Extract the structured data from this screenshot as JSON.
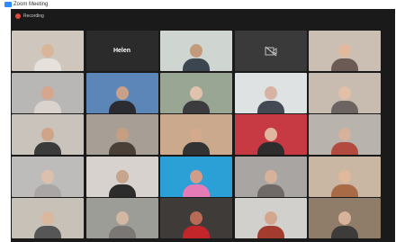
{
  "window": {
    "title": "Zoom Meeting"
  },
  "status": {
    "label": "Recording"
  },
  "tiles": [
    {
      "name": "",
      "kind": "person",
      "bg": "#cfc6be",
      "skin": "#d9b59a",
      "shirt": "#e6e1dc",
      "big_name": ""
    },
    {
      "name": "",
      "kind": "text",
      "bg": "#2b2b2b",
      "skin": "",
      "shirt": "",
      "big_name": "Helen"
    },
    {
      "name": "",
      "kind": "person",
      "bg": "#cfd6d2",
      "skin": "#c49a7d",
      "shirt": "#3b4650",
      "big_name": ""
    },
    {
      "name": "",
      "kind": "camoff",
      "bg": "#3a3a3a",
      "skin": "",
      "shirt": "",
      "big_name": ""
    },
    {
      "name": "",
      "kind": "person",
      "bg": "#cbbfb3",
      "skin": "#e0b99f",
      "shirt": "#6b5b54",
      "big_name": ""
    },
    {
      "name": "",
      "kind": "person",
      "bg": "#b9b7b6",
      "skin": "#d6a68d",
      "shirt": "#d9d2cd",
      "big_name": ""
    },
    {
      "name": "",
      "kind": "person",
      "bg": "#5c86b7",
      "skin": "#c9a08a",
      "shirt": "#2b2c32",
      "big_name": ""
    },
    {
      "name": "",
      "kind": "person",
      "bg": "#9aa694",
      "skin": "#e0c2ad",
      "shirt": "#3c3b3e",
      "big_name": ""
    },
    {
      "name": "",
      "kind": "person",
      "bg": "#dfe2e2",
      "skin": "#d6b3a2",
      "shirt": "#444a54",
      "big_name": ""
    },
    {
      "name": "",
      "kind": "person",
      "bg": "#c8bbaf",
      "skin": "#e2c0a8",
      "shirt": "#6b6460",
      "big_name": ""
    },
    {
      "name": "",
      "kind": "person",
      "bg": "#c9c3bc",
      "skin": "#cfa488",
      "shirt": "#3b3b3b",
      "big_name": ""
    },
    {
      "name": "",
      "kind": "person",
      "bg": "#a79f95",
      "skin": "#c69f83",
      "shirt": "#4b4038",
      "big_name": ""
    },
    {
      "name": "",
      "kind": "person",
      "bg": "#caa98c",
      "skin": "#d3aa8c",
      "shirt": "#333333",
      "big_name": ""
    },
    {
      "name": "",
      "kind": "person",
      "bg": "#c73a44",
      "skin": "#e0b6a0",
      "shirt": "#2d2d2d",
      "big_name": ""
    },
    {
      "name": "",
      "kind": "person",
      "bg": "#b8b3ad",
      "skin": "#d6b19b",
      "shirt": "#b24a3f",
      "big_name": ""
    },
    {
      "name": "",
      "kind": "person",
      "bg": "#bebcbb",
      "skin": "#dcc0ae",
      "shirt": "#aaa6a6",
      "big_name": ""
    },
    {
      "name": "",
      "kind": "person",
      "bg": "#d7d2cd",
      "skin": "#c7a58c",
      "shirt": "#2c2c2c",
      "big_name": ""
    },
    {
      "name": "",
      "kind": "person",
      "bg": "#2aa0d6",
      "skin": "#d19c8a",
      "shirt": "#e47bb7",
      "big_name": ""
    },
    {
      "name": "",
      "kind": "person",
      "bg": "#a9a5a2",
      "skin": "#d7b29b",
      "shirt": "#6f6a67",
      "big_name": ""
    },
    {
      "name": "",
      "kind": "person",
      "bg": "#c9b7a4",
      "skin": "#e0b99c",
      "shirt": "#a86b46",
      "big_name": ""
    },
    {
      "name": "",
      "kind": "person",
      "bg": "#c7c1b7",
      "skin": "#dab89e",
      "shirt": "#565656",
      "big_name": ""
    },
    {
      "name": "",
      "kind": "person",
      "bg": "#9c9d97",
      "skin": "#d2b7a3",
      "shirt": "#7a7774",
      "big_name": ""
    },
    {
      "name": "",
      "kind": "person",
      "bg": "#3f3b39",
      "skin": "#b76b55",
      "shirt": "#c3262a",
      "big_name": ""
    },
    {
      "name": "",
      "kind": "person",
      "bg": "#d2d0cd",
      "skin": "#d1a88d",
      "shirt": "#a33c2f",
      "big_name": ""
    },
    {
      "name": "",
      "kind": "person",
      "bg": "#8f7c69",
      "skin": "#d7b39b",
      "shirt": "#3e3b3b",
      "big_name": ""
    }
  ]
}
